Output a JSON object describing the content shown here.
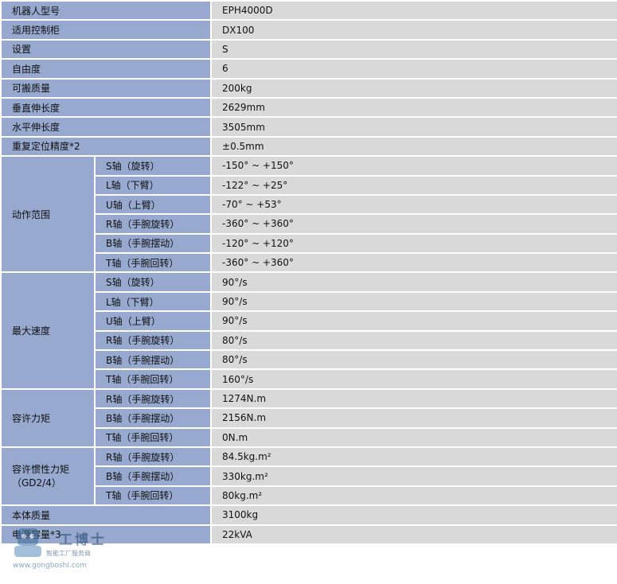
{
  "rows": {
    "model": {
      "label": "机器人型号",
      "value": "EPH4000D"
    },
    "controller": {
      "label": "适用控制柜",
      "value": "DX100"
    },
    "setting": {
      "label": "设置",
      "value": "S"
    },
    "dof": {
      "label": "自由度",
      "value": "6"
    },
    "payload": {
      "label": "可搬质量",
      "value": "200kg"
    },
    "vreach": {
      "label": "垂直伸长度",
      "value": "2629mm"
    },
    "hreach": {
      "label": "水平伸长度",
      "value": "3505mm"
    },
    "repeat": {
      "label": "重复定位精度*2",
      "value": "±0.5mm"
    }
  },
  "motion_range": {
    "label": "动作范围",
    "items": [
      {
        "axis": "S轴（旋转）",
        "value": "-150° ~ +150°"
      },
      {
        "axis": "L轴（下臂）",
        "value": "-122° ~ +25°"
      },
      {
        "axis": "U轴（上臂）",
        "value": "-70° ~ +53°"
      },
      {
        "axis": "R轴（手腕旋转）",
        "value": "-360° ~ +360°"
      },
      {
        "axis": "B轴（手腕摆动）",
        "value": "-120° ~ +120°"
      },
      {
        "axis": "T轴（手腕回转）",
        "value": "-360° ~ +360°"
      }
    ]
  },
  "max_speed": {
    "label": "最大速度",
    "items": [
      {
        "axis": "S轴（旋转）",
        "value": "90°/s"
      },
      {
        "axis": "L轴（下臂）",
        "value": "90°/s"
      },
      {
        "axis": "U轴（上臂）",
        "value": "90°/s"
      },
      {
        "axis": "R轴（手腕旋转）",
        "value": "80°/s"
      },
      {
        "axis": "B轴（手腕摆动）",
        "value": "80°/s"
      },
      {
        "axis": "T轴（手腕回转）",
        "value": "160°/s"
      }
    ]
  },
  "torque": {
    "label": "容许力矩",
    "items": [
      {
        "axis": "R轴（手腕旋转）",
        "value": "1274N.m"
      },
      {
        "axis": "B轴（手腕摆动）",
        "value": "2156N.m"
      },
      {
        "axis": "T轴（手腕回转）",
        "value": "0N.m"
      }
    ]
  },
  "inertia": {
    "label": "容许惯性力矩（GD2/4）",
    "items": [
      {
        "axis": "R轴（手腕旋转）",
        "value": "84.5kg.m²"
      },
      {
        "axis": "B轴（手腕摆动）",
        "value": "330kg.m²"
      },
      {
        "axis": "T轴（手腕回转）",
        "value": "80kg.m²"
      }
    ]
  },
  "tail": {
    "mass": {
      "label": "本体质量",
      "value": "3100kg"
    },
    "power": {
      "label": "电源容量*3",
      "value": "22kVA"
    }
  },
  "watermark": {
    "name": "工博士",
    "tagline": "智能工厂服务商",
    "url": "www.gongboshi.com"
  }
}
